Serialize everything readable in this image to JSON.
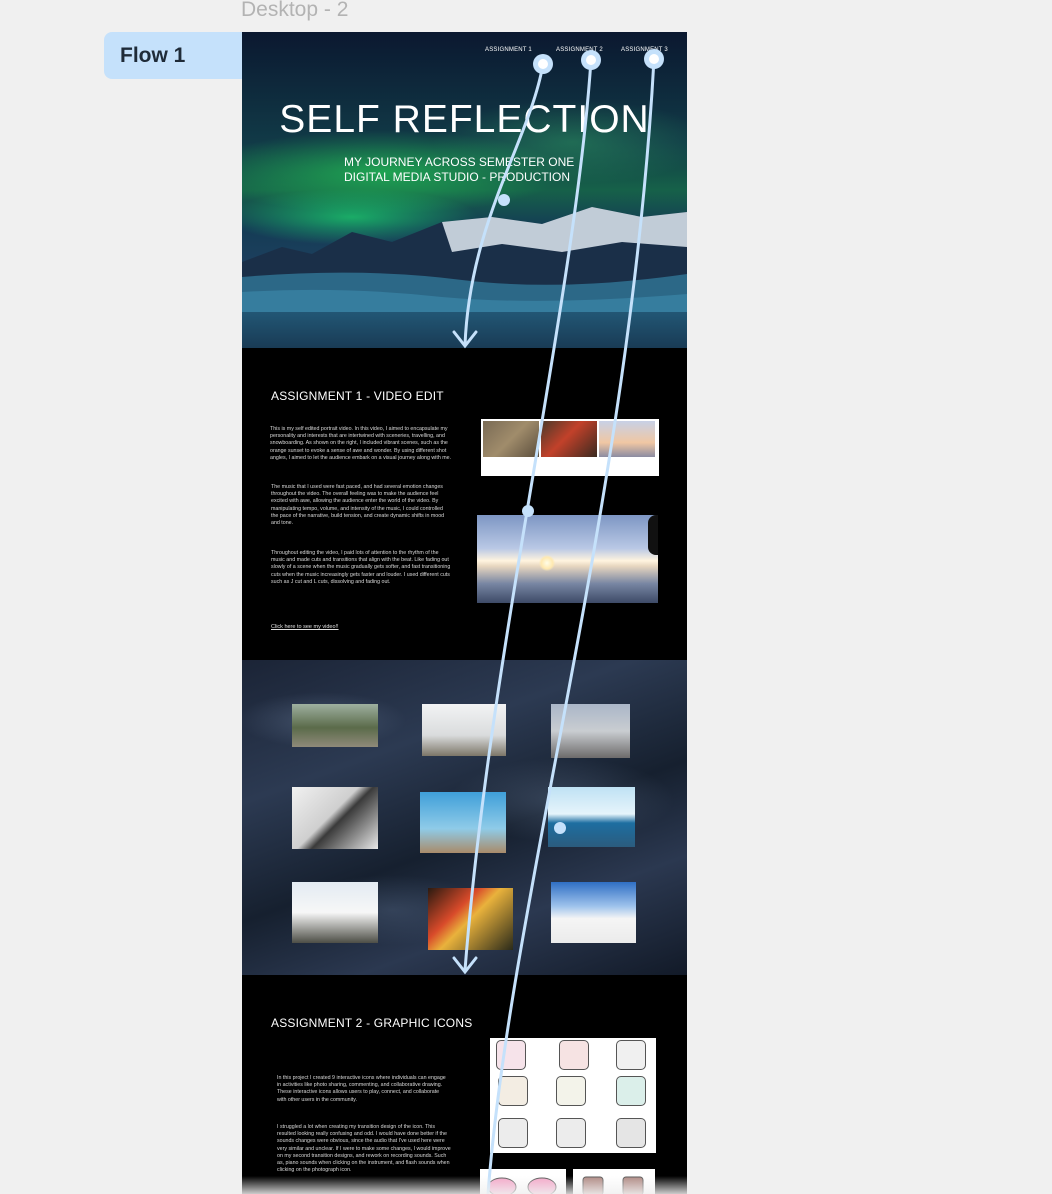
{
  "canvas": {
    "frame_label": "Desktop - 2",
    "flow_label": "Flow 1",
    "colors": {
      "canvas": "#f0f0f0",
      "flow_chip": "#c5e1fb",
      "connector": "#c5e1fb",
      "frame_bg": "#000000"
    }
  },
  "hero": {
    "nav": [
      "ASSIGNMENT 1",
      "ASSIGNMENT 2",
      "ASSIGNMENT 3"
    ],
    "title": "SELF REFLECTION",
    "subtitle_line1": "MY JOURNEY ACROSS SEMESTER ONE",
    "subtitle_line2": "DIGITAL MEDIA STUDIO - PRODUCTION"
  },
  "assignment1": {
    "title": "ASSIGNMENT 1 - VIDEO EDIT",
    "para1": "This is my self edited portrait video. In this video, I aimed to encapsulate my personality and interests that are intertwined with sceneries, travelling, and snowboarding. As shown on the right, I included vibrant scenes, such as the orange sunset to evoke a sense of awe and wonder. By using different shot angles, I aimed to let the audience embark on a visual journey along with me.",
    "para2": "The music that I used were fast paced, and had several emotion changes throughout the video. The overall feeling was to make the audience feel excited with awe, allowing the audience enter the world of the video. By manipulating tempo, volume, and intensity of the music, I could controlled the pace of the narrative, build tension, and create dynamic shifts in mood and tone.",
    "para3": "Throughout editing the video, I paid lots of attention to the rhythm of the music and made cuts and transitions that align with the beat. Like fading out slowly of a scene when the music gradually gets softer, and fast transitioning cuts when the music increasingly gets faster and louder. I used different cuts such as J cut and L cuts, dissolving and fading out.",
    "link": "Click here to see my video!!"
  },
  "assignment2": {
    "title": "ASSIGNMENT 2 - GRAPHIC ICONS",
    "para1": "In this project I created 9 interactive icons where individuals can engage in activities like photo sharing, commenting, and collaborative drawing. These interactive icons allows users to play, connect, and collaborate with other users in the community.",
    "para2": "I struggled a lot when creating my transition design of the icon. This resulted looking really confusing and odd. I would have done better if the sounds changes were obvious, since the audio that I've used here were very similar and unclear. If I were to make some changes, I would improve on my second transition designs, and rework on recording sounds. Such as, piano sounds when clicking on the instrument, and flash sounds when clicking on the photograph icon."
  }
}
